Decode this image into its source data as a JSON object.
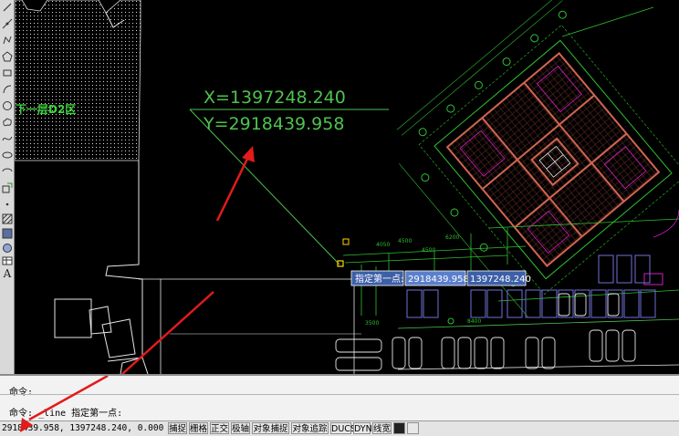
{
  "canvas": {
    "region_label": "下一层D2区",
    "x_readout": "X=1397248.240",
    "y_readout": "Y=2918439.958",
    "dim_labels": [
      "4050",
      "4500",
      "4500",
      "6200",
      "3500",
      "8400"
    ],
    "prompt": {
      "label": "指定第一点:",
      "value_1": "2918439.958",
      "value_2": "1397248.240"
    }
  },
  "command": {
    "line1": "命令:",
    "line2": "命令: _line 指定第一点:"
  },
  "status": {
    "coords": "2918439.958, 1397248.240, 0.000",
    "buttons": [
      "捕捉",
      "栅格",
      "正交",
      "极轴",
      "对象捕捉",
      "对象追踪",
      "DUCS",
      "DYN",
      "线宽"
    ]
  },
  "toolbar": {
    "icons": [
      "line-icon",
      "construction-line-icon",
      "polyline-icon",
      "polygon-icon",
      "rectangle-icon",
      "arc-icon",
      "circle-icon",
      "revision-cloud-icon",
      "spline-icon",
      "ellipse-icon",
      "ellipse-arc-icon",
      "insert-block-icon",
      "make-block-icon",
      "point-icon",
      "hatch-icon",
      "gradient-icon",
      "region-icon",
      "table-icon",
      "multiline-text-icon"
    ],
    "text_tool": "A"
  },
  "colors": {
    "drawing_line": "#2fbf2f",
    "wall": "#c85a4a",
    "annotation_arrow": "#e21b1b",
    "prompt_bg": "#3d5fa8",
    "grip": "#ffd400"
  }
}
